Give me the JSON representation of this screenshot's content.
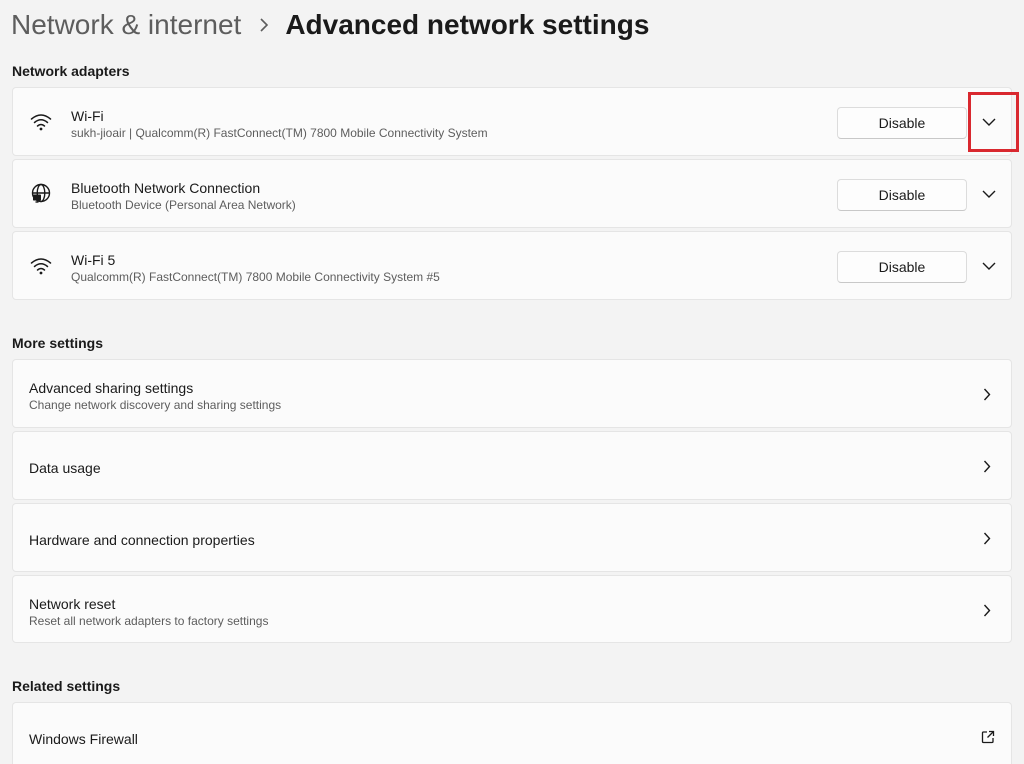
{
  "breadcrumb": {
    "parent": "Network & internet",
    "current": "Advanced network settings"
  },
  "sections": {
    "adapters": "Network adapters",
    "more": "More settings",
    "related": "Related settings"
  },
  "adapters": [
    {
      "name": "Wi-Fi",
      "description": "sukh-jioair | Qualcomm(R) FastConnect(TM) 7800 Mobile Connectivity System",
      "button": "Disable",
      "icon": "wifi-icon"
    },
    {
      "name": "Bluetooth Network Connection",
      "description": "Bluetooth Device (Personal Area Network)",
      "button": "Disable",
      "icon": "globe-network-icon"
    },
    {
      "name": "Wi-Fi 5",
      "description": "Qualcomm(R) FastConnect(TM) 7800 Mobile Connectivity System #5",
      "button": "Disable",
      "icon": "wifi-icon"
    }
  ],
  "more_settings": [
    {
      "title": "Advanced sharing settings",
      "subtitle": "Change network discovery and sharing settings"
    },
    {
      "title": "Data usage",
      "subtitle": ""
    },
    {
      "title": "Hardware and connection properties",
      "subtitle": ""
    },
    {
      "title": "Network reset",
      "subtitle": "Reset all network adapters to factory settings"
    }
  ],
  "related_settings": [
    {
      "title": "Windows Firewall",
      "icon": "external-link-icon"
    }
  ],
  "colors": {
    "background": "#f3f3f3",
    "card": "#fbfbfb",
    "highlight": "#d9282f"
  }
}
